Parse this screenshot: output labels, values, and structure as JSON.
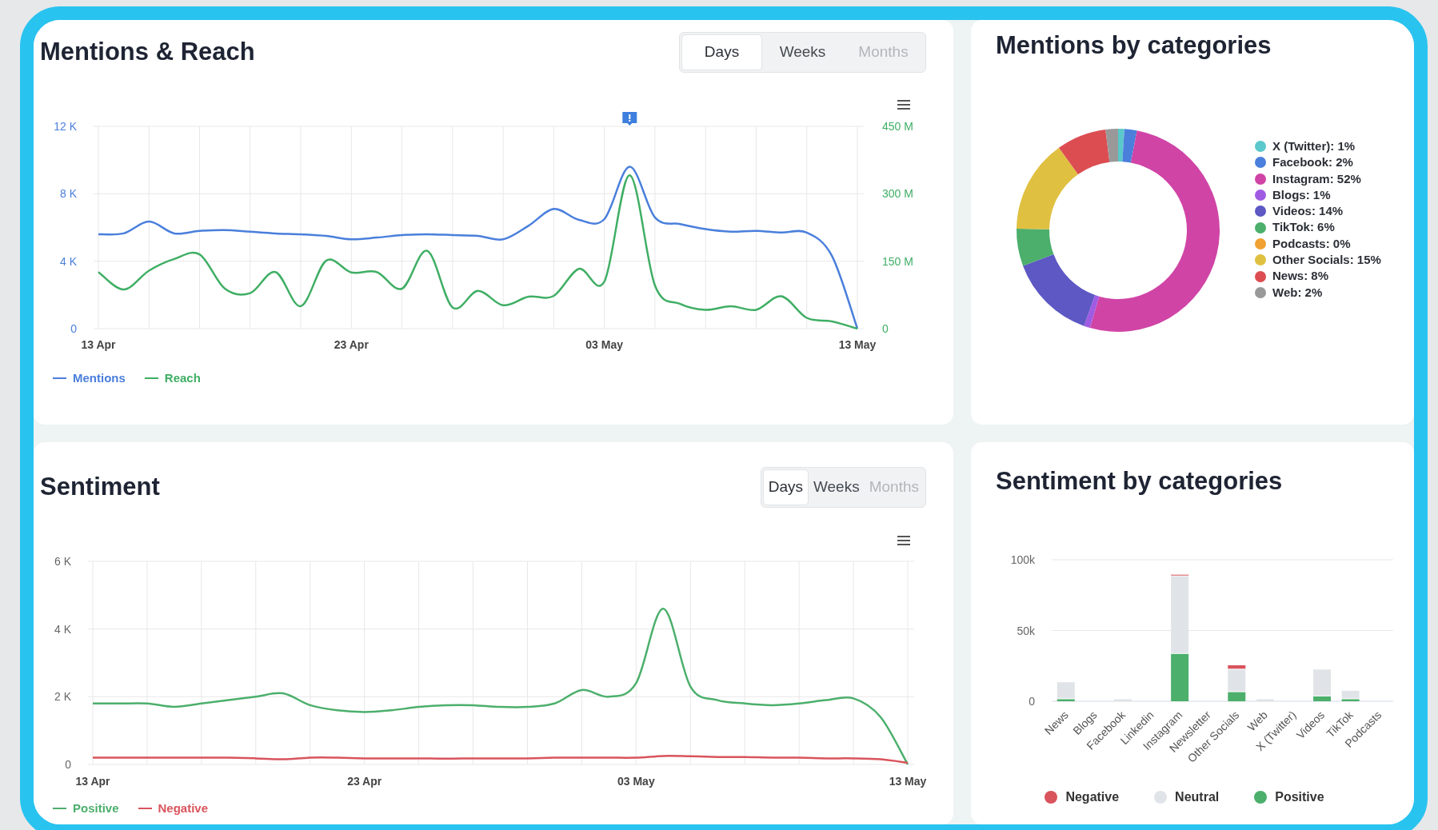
{
  "panels": [
    {
      "kind": "line",
      "title": "Mentions & Reach",
      "alert_marker": true,
      "tabs": [
        {
          "label": "Days",
          "selected": true,
          "disabled": false
        },
        {
          "label": "Weeks",
          "selected": false,
          "disabled": false
        },
        {
          "label": "Months",
          "selected": false,
          "disabled": true
        }
      ],
      "chart_data": {
        "type": "line",
        "categories": [
          "13 Apr",
          null,
          null,
          null,
          null,
          null,
          null,
          null,
          null,
          null,
          "23 Apr",
          null,
          null,
          null,
          null,
          null,
          null,
          null,
          null,
          null,
          "03 May",
          null,
          null,
          null,
          null,
          null,
          null,
          null,
          null,
          null,
          "13 May"
        ],
        "ylim": [
          0,
          12
        ],
        "yticks": [
          {
            "value": 0,
            "label": "0"
          },
          {
            "value": 4,
            "label": "4 K"
          },
          {
            "value": 8,
            "label": "8 K"
          },
          {
            "value": 12,
            "label": "12 K"
          }
        ],
        "y2lim": [
          0,
          450
        ],
        "y2ticks": [
          {
            "value": 0,
            "label": "0"
          },
          {
            "value": 150,
            "label": "150 M"
          },
          {
            "value": 300,
            "label": "300 M"
          },
          {
            "value": 450,
            "label": "450 M"
          }
        ],
        "series": [
          {
            "name": "Mentions",
            "color": "#4a7fdc",
            "values": [
              5.6,
              5.65,
              6.35,
              5.65,
              5.8,
              5.85,
              5.75,
              5.65,
              5.6,
              5.5,
              5.3,
              5.4,
              5.55,
              5.6,
              5.55,
              5.5,
              5.3,
              6.1,
              7.1,
              6.45,
              6.5,
              9.6,
              6.6,
              6.2,
              5.9,
              5.75,
              5.8,
              5.7,
              5.7,
              4.3,
              0
            ]
          },
          {
            "name": "Reach",
            "color": "#3fae64",
            "axis": "y2",
            "values": [
              126,
              87,
              129,
              155,
              165,
              89,
              79,
              126,
              50,
              151,
              125,
              126,
              89,
              173,
              47,
              84,
              52,
              71,
              73,
              133,
              105,
              341,
              96,
              55,
              42,
              50,
              42,
              72,
              24,
              16,
              0
            ]
          }
        ],
        "grid": true
      }
    },
    {
      "kind": "donut",
      "title": "Mentions by categories",
      "slices": [
        {
          "color": "#5bc8cb"
        },
        {
          "color": "#4a7fdc"
        },
        {
          "color": "#d044a6"
        },
        {
          "color": "#a05be3"
        },
        {
          "color": "#5d58c4"
        },
        {
          "color": "#4caf6c"
        },
        {
          "color": "#f0a132"
        },
        {
          "color": "#e0c040"
        },
        {
          "color": "#dc4d52"
        },
        {
          "color": "#999999"
        }
      ],
      "chart_data": {
        "type": "donut",
        "categories": [
          "X (Twitter): 1%",
          "Facebook: 2%",
          "Instagram: 52%",
          "Blogs: 1%",
          "Videos: 14%",
          "TikTok: 6%",
          "Podcasts: 0%",
          "Other Socials: 15%",
          "News: 8%",
          "Web: 2%"
        ],
        "series": [
          {
            "values": [
              1,
              2,
              52,
              1,
              14,
              6,
              0,
              15,
              8,
              2
            ]
          }
        ]
      }
    },
    {
      "kind": "line",
      "title": "Sentiment",
      "tabs": [
        {
          "label": "Days",
          "selected": true,
          "disabled": false
        },
        {
          "label": "Weeks",
          "selected": false,
          "disabled": false
        },
        {
          "label": "Months",
          "selected": false,
          "disabled": true
        }
      ],
      "chart_data": {
        "type": "line",
        "categories": [
          "13 Apr",
          null,
          null,
          null,
          null,
          null,
          null,
          null,
          null,
          null,
          "23 Apr",
          null,
          null,
          null,
          null,
          null,
          null,
          null,
          null,
          null,
          "03 May",
          null,
          null,
          null,
          null,
          null,
          null,
          null,
          null,
          null,
          "13 May"
        ],
        "ylim": [
          0,
          6
        ],
        "yticks": [
          {
            "value": 0,
            "label": "0"
          },
          {
            "value": 2,
            "label": "2 K"
          },
          {
            "value": 4,
            "label": "4 K"
          },
          {
            "value": 6,
            "label": "6 K"
          }
        ],
        "series": [
          {
            "name": "Positive",
            "color": "#4caf6c",
            "values": [
              1.8,
              1.8,
              1.8,
              1.7,
              1.8,
              1.9,
              2.0,
              2.1,
              1.75,
              1.6,
              1.55,
              1.6,
              1.7,
              1.75,
              1.75,
              1.7,
              1.7,
              1.8,
              2.2,
              2.0,
              2.4,
              4.6,
              2.3,
              1.9,
              1.8,
              1.75,
              1.8,
              1.9,
              1.95,
              1.4,
              0
            ]
          },
          {
            "name": "Negative",
            "color": "#d9545c",
            "values": [
              0.2,
              0.2,
              0.2,
              0.2,
              0.2,
              0.2,
              0.18,
              0.15,
              0.2,
              0.2,
              0.18,
              0.18,
              0.18,
              0.17,
              0.18,
              0.18,
              0.18,
              0.2,
              0.2,
              0.2,
              0.2,
              0.25,
              0.24,
              0.22,
              0.22,
              0.2,
              0.2,
              0.18,
              0.18,
              0.15,
              0.05
            ]
          }
        ],
        "grid": true
      }
    },
    {
      "kind": "bar",
      "title": "Sentiment by categories",
      "chart_data": {
        "type": "bar",
        "stacked": true,
        "categories": [
          "News",
          "Blogs",
          "Facebook",
          "Linkedin",
          "Instagram",
          "Newsletter",
          "Other Socials",
          "Web",
          "X (Twitter)",
          "Videos",
          "TikTok",
          "Podcasts"
        ],
        "ylim": [
          0,
          100
        ],
        "yticks": [
          {
            "value": 0,
            "label": "0"
          },
          {
            "value": 50,
            "label": "50k"
          },
          {
            "value": 100,
            "label": "100k"
          }
        ],
        "series": [
          {
            "name": "Negative",
            "color": "#d9545c",
            "values": [
              0,
              0,
              0,
              0,
              1,
              0,
              3,
              0,
              0,
              0,
              0,
              0
            ]
          },
          {
            "name": "Neutral",
            "color": "#e0e4e8",
            "values": [
              12,
              0,
              2,
              0,
              55,
              0,
              16,
              2,
              0,
              19,
              6,
              0
            ]
          },
          {
            "name": "Positive",
            "color": "#4caf6c",
            "values": [
              2,
              0,
              0,
              0,
              34,
              0,
              7,
              0,
              0,
              4,
              2,
              0
            ]
          }
        ]
      }
    }
  ]
}
